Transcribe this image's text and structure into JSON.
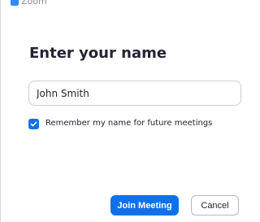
{
  "window": {
    "title": "Zoom",
    "icon": "zoom-app-icon"
  },
  "dialog": {
    "heading": "Enter your name",
    "name_input": {
      "value": "John Smith",
      "placeholder": ""
    },
    "remember": {
      "label": "Remember my name for future meetings",
      "checked": true,
      "icon": "checkmark-icon"
    },
    "buttons": {
      "join_label": "Join Meeting",
      "cancel_label": "Cancel"
    }
  },
  "colors": {
    "accent": "#0e71eb",
    "text": "#232333",
    "title_text": "#8c8c8c",
    "border": "#cfcfd4"
  }
}
